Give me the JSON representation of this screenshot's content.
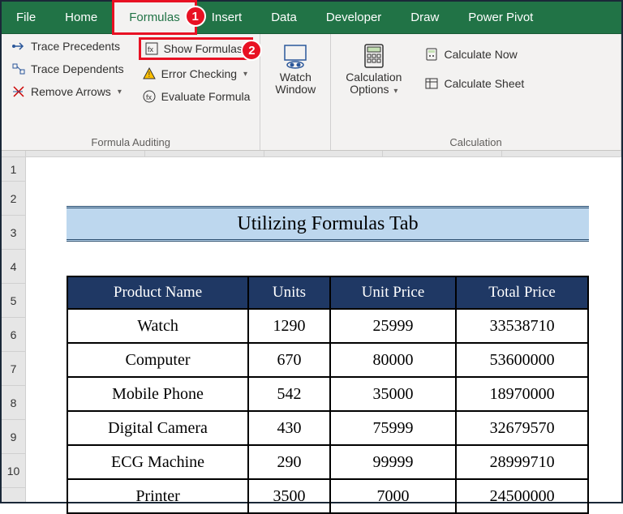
{
  "tabs": {
    "file": "File",
    "home": "Home",
    "formulas": "Formulas",
    "insert": "Insert",
    "data": "Data",
    "developer": "Developer",
    "draw": "Draw",
    "powerpivot": "Power Pivot"
  },
  "callouts": {
    "one": "1",
    "two": "2"
  },
  "ribbon": {
    "trace_precedents": "Trace Precedents",
    "trace_dependents": "Trace Dependents",
    "remove_arrows": "Remove Arrows",
    "show_formulas": "Show Formulas",
    "error_checking": "Error Checking",
    "evaluate_formula": "Evaluate Formula",
    "watch_window": "Watch Window",
    "calculation_options": "Calculation Options",
    "calculate_now": "Calculate Now",
    "calculate_sheet": "Calculate Sheet",
    "group_auditing": "Formula Auditing",
    "group_calculation": "Calculation"
  },
  "rows": {
    "r1": "1",
    "r2": "2",
    "r3": "3",
    "r4": "4",
    "r5": "5",
    "r6": "6",
    "r7": "7",
    "r8": "8",
    "r9": "9",
    "r10": "10"
  },
  "title": "Utilizing Formulas Tab",
  "headers": {
    "product": "Product Name",
    "units": "Units",
    "price": "Unit Price",
    "total": "Total Price"
  },
  "data": [
    {
      "product": "Watch",
      "units": "1290",
      "price": "25999",
      "total": "33538710"
    },
    {
      "product": "Computer",
      "units": "670",
      "price": "80000",
      "total": "53600000"
    },
    {
      "product": "Mobile Phone",
      "units": "542",
      "price": "35000",
      "total": "18970000"
    },
    {
      "product": "Digital Camera",
      "units": "430",
      "price": "75999",
      "total": "32679570"
    },
    {
      "product": "ECG Machine",
      "units": "290",
      "price": "99999",
      "total": "28999710"
    },
    {
      "product": "Printer",
      "units": "3500",
      "price": "7000",
      "total": "24500000"
    }
  ]
}
